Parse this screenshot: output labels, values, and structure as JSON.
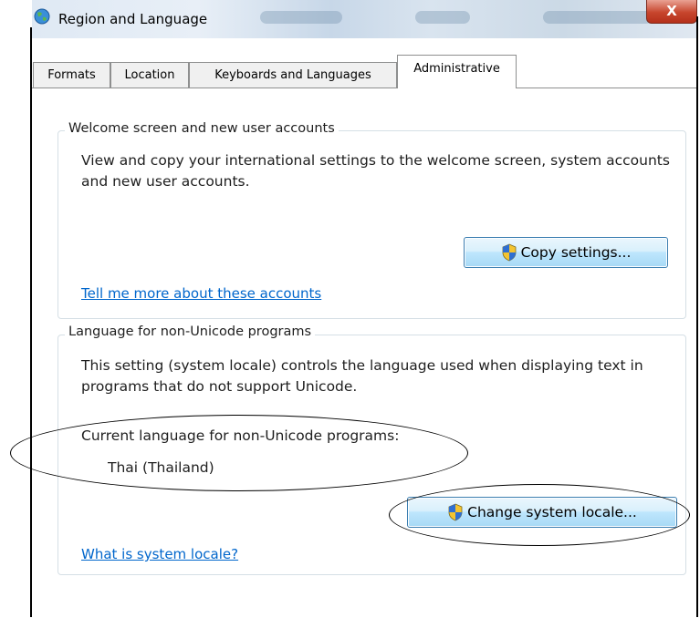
{
  "window": {
    "title": "Region and Language",
    "close_glyph": "X"
  },
  "tabs": [
    {
      "label": "Formats"
    },
    {
      "label": "Location"
    },
    {
      "label": "Keyboards and Languages"
    },
    {
      "label": "Administrative"
    }
  ],
  "welcome_group": {
    "title": "Welcome screen and new user accounts",
    "description": "View and copy your international settings to the welcome screen, system accounts and new user accounts.",
    "button_label": "Copy settings...",
    "link": "Tell me more about these accounts"
  },
  "nonunicode_group": {
    "title": "Language for non-Unicode programs",
    "description": "This setting (system locale) controls the language used when displaying text in programs that do not support Unicode.",
    "current_label": "Current language for non-Unicode programs:",
    "current_value": "Thai (Thailand)",
    "button_label": "Change system locale...",
    "link": "What is system locale?"
  },
  "colors": {
    "link": "#0066cc",
    "group_border": "#d5dfe5",
    "button_border": "#3c7fb1",
    "close": "#c7452d"
  }
}
